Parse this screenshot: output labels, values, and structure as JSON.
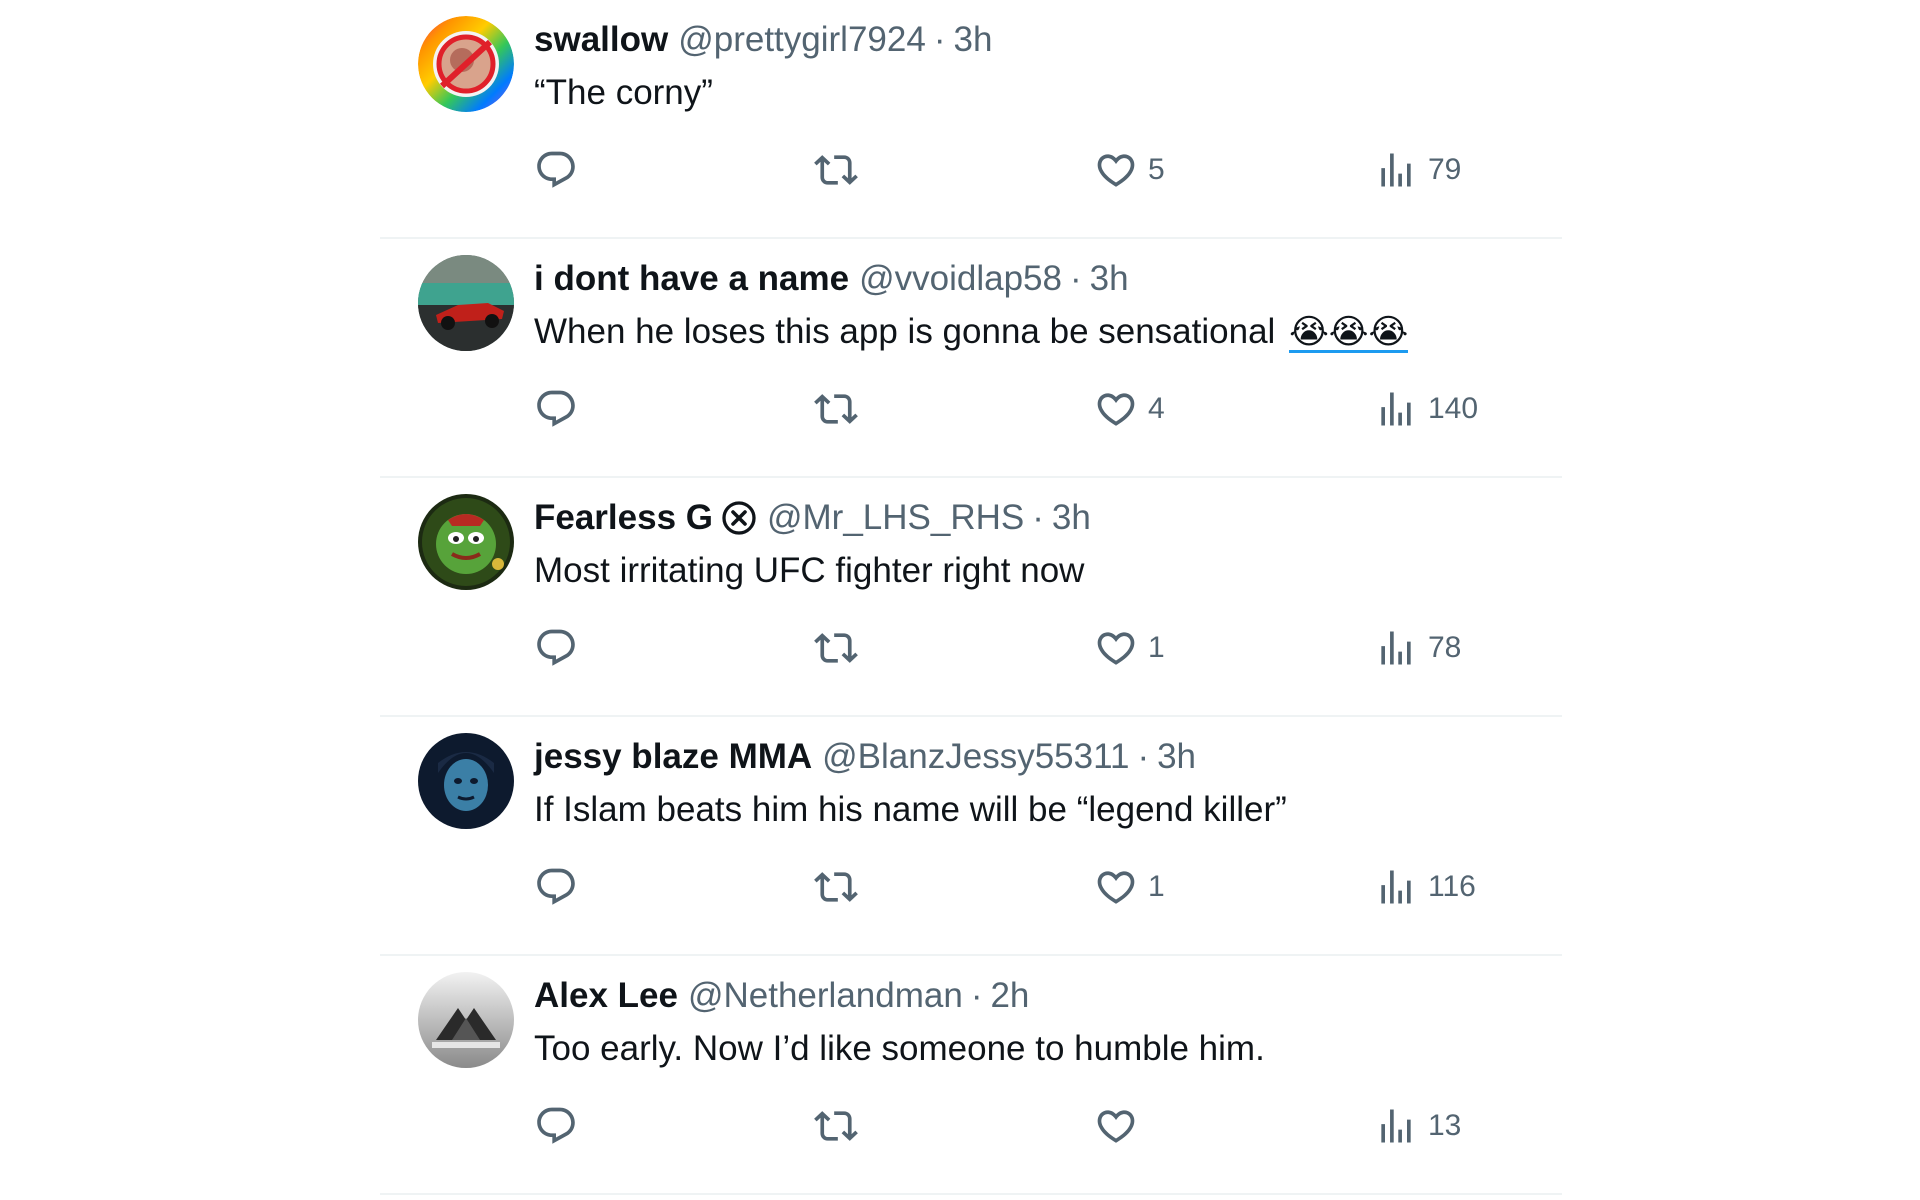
{
  "tweets": [
    {
      "display_name": "swallow",
      "handle": "@prettygirl7924",
      "separator": "·",
      "time": "3h",
      "text": "“The corny”",
      "emoji": "",
      "verified": false,
      "avatar_icon": "rainbow-ring-avatar",
      "likes": "5",
      "views": "79"
    },
    {
      "display_name": "i dont have a name",
      "handle": "@vvoidlap58",
      "separator": "·",
      "time": "3h",
      "text": "When he loses this app is gonna be sensational",
      "emoji": "😭😭😭",
      "verified": false,
      "avatar_icon": "race-car-avatar",
      "likes": "4",
      "views": "140"
    },
    {
      "display_name": "Fearless G",
      "handle": "@Mr_LHS_RHS",
      "separator": "·",
      "time": "3h",
      "text": "Most irritating UFC fighter right now",
      "emoji": "",
      "verified": true,
      "avatar_icon": "frog-avatar",
      "likes": "1",
      "views": "78"
    },
    {
      "display_name": "jessy blaze MMA",
      "handle": "@BlanzJessy55311",
      "separator": "·",
      "time": "3h",
      "text": "If Islam beats him his name will be “legend killer”",
      "emoji": "",
      "verified": false,
      "avatar_icon": "dark-blue-face-avatar",
      "likes": "1",
      "views": "116"
    },
    {
      "display_name": "Alex Lee",
      "handle": "@Netherlandman",
      "separator": "·",
      "time": "2h",
      "text": "Too early. Now I’d like someone to humble him.",
      "emoji": "",
      "verified": false,
      "avatar_icon": "mountain-logo-avatar",
      "likes": "",
      "views": "13"
    }
  ],
  "colors": {
    "primary_text": "#0f1419",
    "secondary_text": "#536471",
    "divider": "#eff3f4",
    "link_underline": "#1d9bf0"
  }
}
